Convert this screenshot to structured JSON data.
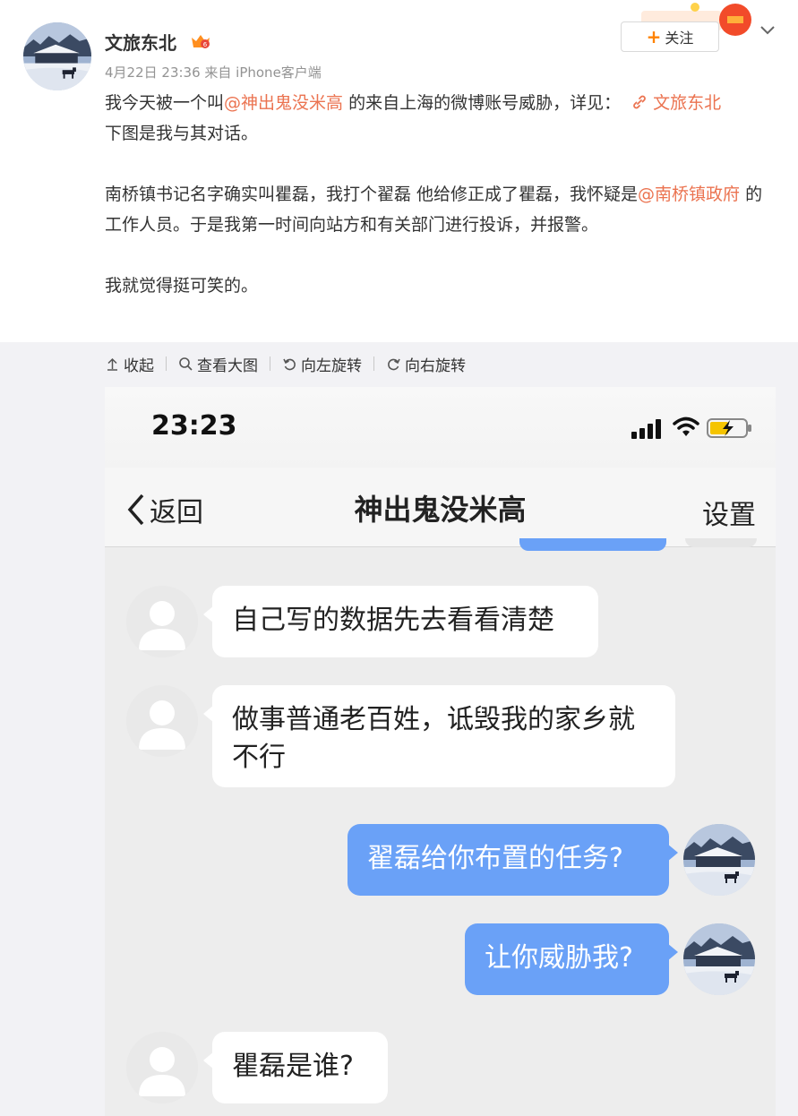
{
  "post": {
    "author": "文旅东北",
    "meta": "4月22日 23:36 来自 iPhone客户端",
    "follow_label": "关注",
    "line1_before": "我今天被一个叫",
    "mention_1": "@神出鬼没米高",
    "line1_after": " 的来自上海的微博账号威胁，详见：",
    "article_link": "文旅东北",
    "line2": "下图是我与其对话。",
    "para2_before": "南桥镇书记名字确实叫瞿磊，我打个翟磊 他给修正成了瞿磊，我怀疑是",
    "mention_2": "@南桥镇政府",
    "para2_after": " 的工作人员。于是我第一时间向站方和有关部门进行投诉，并报警。",
    "para3": "我就觉得挺可笑的。"
  },
  "toolbar": {
    "collapse": "收起",
    "view_large": "查看大图",
    "rotate_left": "向左旋转",
    "rotate_right": "向右旋转"
  },
  "screenshot": {
    "time": "23:23",
    "back_label": "返回",
    "chat_title": "神出鬼没米高",
    "settings_label": "设置",
    "messages": [
      {
        "side": "in",
        "text": "自己写的数据先去看看清楚"
      },
      {
        "side": "in",
        "text": "做事普通老百姓，诋毁我的家乡就不行"
      },
      {
        "side": "out",
        "text": "翟磊给你布置的任务?"
      },
      {
        "side": "out",
        "text": "让你威胁我?"
      },
      {
        "side": "in",
        "text": "瞿磊是谁?"
      }
    ]
  },
  "colors": {
    "link": "#eb7350",
    "accent_orange": "#ff8200",
    "bubble_out": "#6aa1f7",
    "page_gray": "#f2f2f5"
  }
}
